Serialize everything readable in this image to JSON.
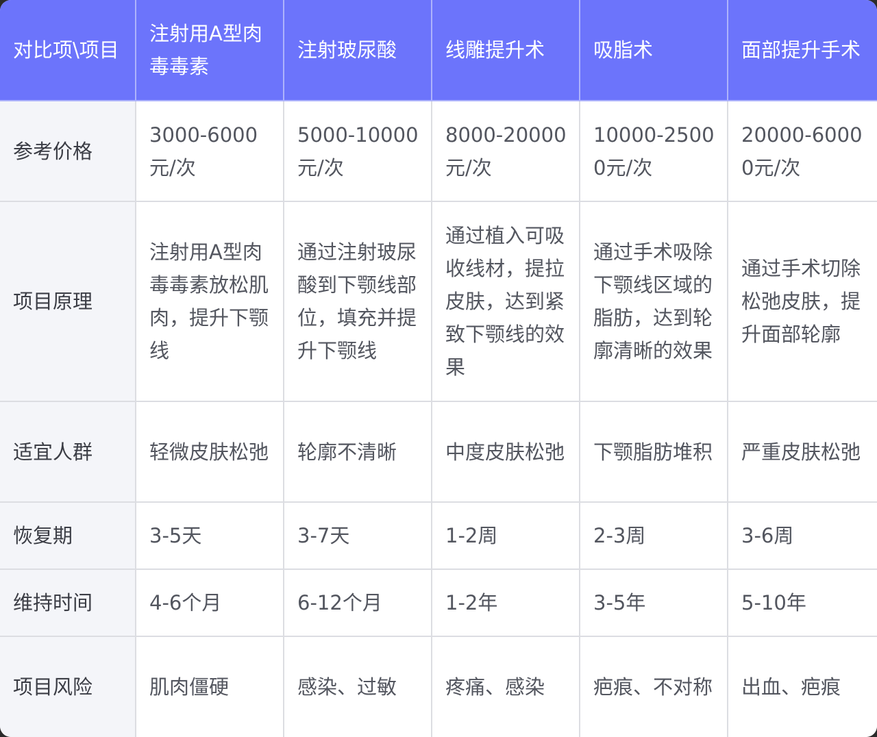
{
  "table": {
    "headers": [
      "对比项\\项目",
      "注射用A型肉毒毒素",
      "注射玻尿酸",
      "线雕提升术",
      "吸脂术",
      "面部提升手术"
    ],
    "rows": [
      {
        "label": "参考价格",
        "cells": [
          "3000-6000元/次",
          "5000-10000元/次",
          "8000-20000元/次",
          "10000-25000元/次",
          "20000-60000元/次"
        ]
      },
      {
        "label": "项目原理",
        "cells": [
          "注射用A型肉毒毒素放松肌肉，提升下颚线",
          "通过注射玻尿酸到下颚线部位，填充并提升下颚线",
          "通过植入可吸收线材，提拉皮肤，达到紧致下颚线的效果",
          "通过手术吸除下颚线区域的脂肪，达到轮廓清晰的效果",
          "通过手术切除松弛皮肤，提升面部轮廓"
        ]
      },
      {
        "label": "适宜人群",
        "cells": [
          "轻微皮肤松弛",
          "轮廓不清晰",
          "中度皮肤松弛",
          "下颚脂肪堆积",
          "严重皮肤松弛"
        ]
      },
      {
        "label": "恢复期",
        "cells": [
          "3-5天",
          "3-7天",
          "1-2周",
          "2-3周",
          "3-6周"
        ]
      },
      {
        "label": "维持时间",
        "cells": [
          "4-6个月",
          "6-12个月",
          "1-2年",
          "3-5年",
          "5-10年"
        ]
      },
      {
        "label": "项目风险",
        "cells": [
          "肌肉僵硬",
          "感染、过敏",
          "疼痛、感染",
          "疤痕、不对称",
          "出血、疤痕"
        ]
      }
    ]
  },
  "colors": {
    "header_background": "#6c74fb",
    "header_text": "#ffffff",
    "label_column_background": "#f4f5f9",
    "cell_background": "#ffffff",
    "border": "#dcdde2"
  }
}
